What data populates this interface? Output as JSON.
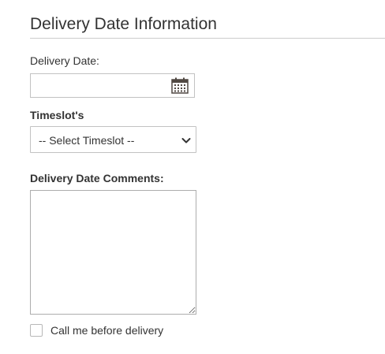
{
  "section": {
    "title": "Delivery Date Information"
  },
  "delivery_date": {
    "label": "Delivery Date:",
    "value": "",
    "icon": "calendar-icon"
  },
  "timeslot": {
    "label": "Timeslot's",
    "selected": "-- Select Timeslot --",
    "icon": "chevron-down-icon"
  },
  "comments": {
    "label": "Delivery Date Comments:",
    "value": ""
  },
  "call_before": {
    "label": "Call me before delivery",
    "checked": false
  },
  "colors": {
    "text": "#333333",
    "border": "#c2c2c2",
    "rule": "#cccccc"
  }
}
